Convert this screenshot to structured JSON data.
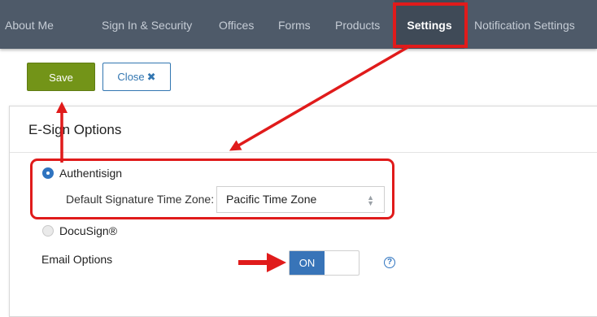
{
  "nav": {
    "items": [
      {
        "label": "About Me"
      },
      {
        "label": "Sign In & Security"
      },
      {
        "label": "Offices"
      },
      {
        "label": "Forms"
      },
      {
        "label": "Products"
      },
      {
        "label": "Settings",
        "active": true
      },
      {
        "label": "Notification Settings"
      }
    ]
  },
  "toolbar": {
    "save_label": "Save",
    "close_label": "Close",
    "close_icon": "✖"
  },
  "panel": {
    "title": "E-Sign Options",
    "options": [
      {
        "label": "Authentisign",
        "checked": true
      },
      {
        "label": "DocuSign®",
        "checked": false
      }
    ],
    "timezone_label": "Default Signature Time Zone:",
    "timezone_value": "Pacific Time Zone",
    "email_options_label": "Email Options",
    "email_toggle_state": "ON",
    "help_icon": "?"
  },
  "colors": {
    "nav_bg": "#4e5a69",
    "save_green": "#739418",
    "accent_blue": "#2f74c0",
    "annotation_red": "#e01b1b"
  }
}
